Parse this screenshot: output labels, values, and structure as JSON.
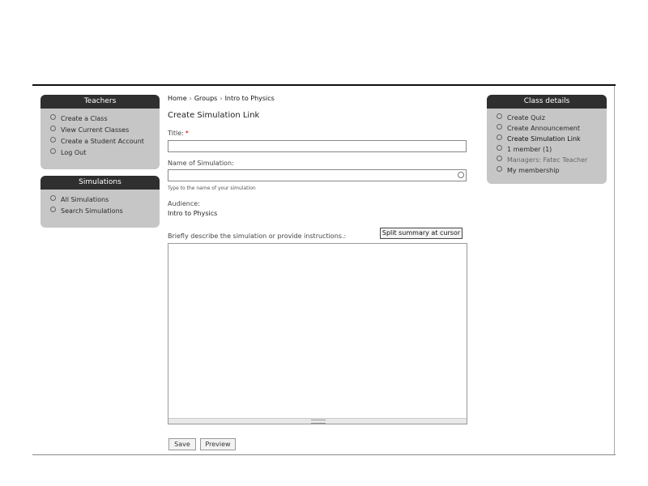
{
  "sidebar": {
    "teachers": {
      "title": "Teachers",
      "items": [
        "Create a Class",
        "View Current Classes",
        "Create a Student Account",
        "Log Out"
      ]
    },
    "simulations": {
      "title": "Simulations",
      "items": [
        "All Simulations",
        "Search Simulations"
      ]
    }
  },
  "class_details": {
    "title": "Class details",
    "items": [
      "Create Quiz",
      "Create Announcement",
      "Create Simulation Link",
      "1 member (1)",
      "Managers: Fatec Teacher",
      "My membership"
    ]
  },
  "breadcrumb": [
    "Home",
    "Groups",
    "Intro to Physics"
  ],
  "breadcrumb_sep": "›",
  "page_title": "Create Simulation Link",
  "form": {
    "title_label": "Title:",
    "required_mark": "*",
    "title_value": "",
    "simulation_label": "Name of Simulation:",
    "simulation_value": "",
    "simulation_hint": "Type to the name of your simulation",
    "audience_label": "Audience:",
    "audience_value": "Intro to Physics",
    "description_label": "Briefly describe the simulation or provide instructions.:",
    "split_button": "Split summary at cursor",
    "description_value": "",
    "save_button": "Save",
    "preview_button": "Preview"
  },
  "icons": {
    "bullet": "circle-bullet-icon",
    "autocomplete": "autocomplete-throbber-icon",
    "resize": "resize-grip-icon"
  }
}
